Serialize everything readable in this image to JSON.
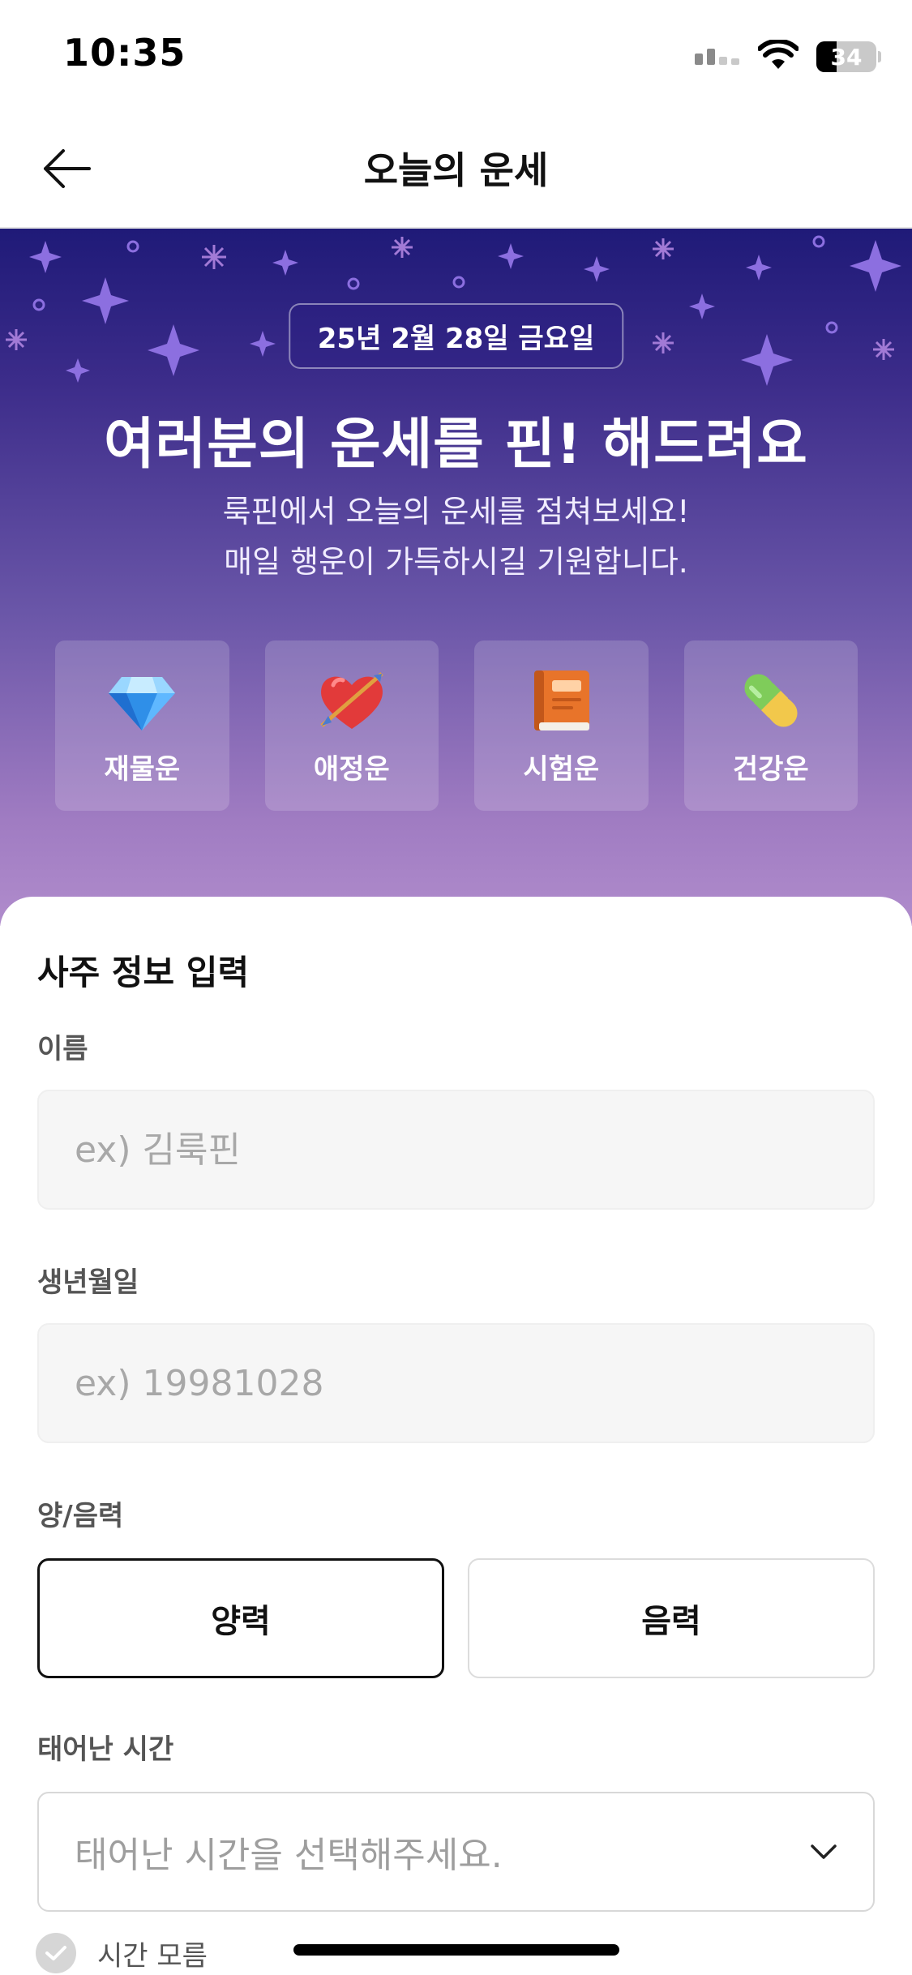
{
  "status_bar": {
    "time": "10:35",
    "battery": "34",
    "icons": [
      "cellular-signal-icon",
      "wifi-icon",
      "battery-icon"
    ]
  },
  "header": {
    "back_icon": "arrow-left-icon",
    "title": "오늘의 운세"
  },
  "hero": {
    "date": "25년 2월 28일 금요일",
    "title": "여러분의 운세를 핀! 해드려요",
    "subtitle_line1": "룩핀에서 오늘의 운세를 점쳐보세요!",
    "subtitle_line2": "매일 행운이 가득하시길 기원합니다.",
    "fortunes": [
      {
        "label": "재물운",
        "icon": "gem-icon"
      },
      {
        "label": "애정운",
        "icon": "heart-arrow-icon"
      },
      {
        "label": "시험운",
        "icon": "book-icon"
      },
      {
        "label": "건강운",
        "icon": "pill-icon"
      }
    ],
    "colors": {
      "top": "#1f1a78",
      "bottom": "#b08ccc"
    }
  },
  "form": {
    "section_title": "사주 정보 입력",
    "name": {
      "label": "이름",
      "placeholder": "ex) 김룩핀",
      "value": ""
    },
    "birth": {
      "label": "생년월일",
      "placeholder": "ex) 19981028",
      "value": ""
    },
    "calendar": {
      "label": "양/음력",
      "options": [
        "양력",
        "음력"
      ],
      "selected": "양력"
    },
    "birth_time": {
      "label": "태어난 시간",
      "placeholder": "태어난 시간을 선택해주세요.",
      "icon": "chevron-down-icon"
    },
    "unknown_time": {
      "label": "시간 모름",
      "checked": false
    }
  }
}
